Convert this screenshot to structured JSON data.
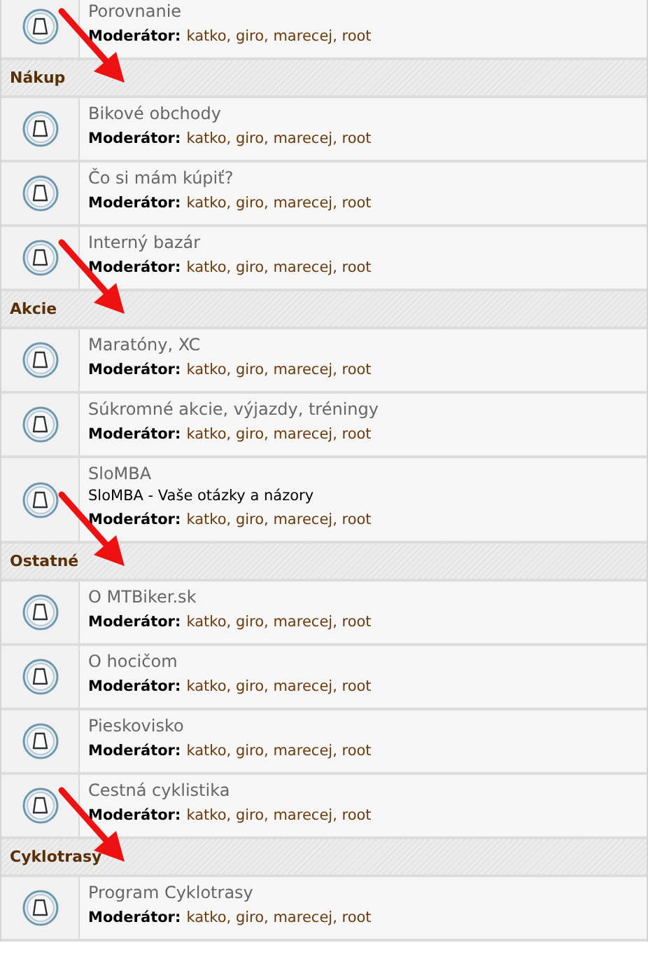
{
  "top_forums": [
    {
      "title": "Porovnanie",
      "moderator_label": "Moderátor:",
      "moderators": "katko, giro, marecej, root"
    }
  ],
  "categories": [
    {
      "name": "Nákup",
      "arrow": true,
      "forums": [
        {
          "title": "Bikové obchody",
          "moderator_label": "Moderátor:",
          "moderators": "katko, giro, marecej, root"
        },
        {
          "title": "Čo si mám kúpiť?",
          "moderator_label": "Moderátor:",
          "moderators": "katko, giro, marecej, root"
        },
        {
          "title": "Interný bazár",
          "moderator_label": "Moderátor:",
          "moderators": "katko, giro, marecej, root"
        }
      ]
    },
    {
      "name": "Akcie",
      "arrow": true,
      "forums": [
        {
          "title": "Maratóny, XC",
          "moderator_label": "Moderátor:",
          "moderators": "katko, giro, marecej, root"
        },
        {
          "title": "Súkromné akcie, výjazdy, tréningy",
          "moderator_label": "Moderátor:",
          "moderators": "katko, giro, marecej, root"
        },
        {
          "title": "SloMBA",
          "description": "SloMBA - Vaše otázky a názory",
          "moderator_label": "Moderátor:",
          "moderators": "katko, giro, marecej, root"
        }
      ]
    },
    {
      "name": "Ostatné",
      "arrow": true,
      "forums": [
        {
          "title": "O MTBiker.sk",
          "moderator_label": "Moderátor:",
          "moderators": "katko, giro, marecej, root"
        },
        {
          "title": "O hocičom",
          "moderator_label": "Moderátor:",
          "moderators": "katko, giro, marecej, root"
        },
        {
          "title": "Pieskovisko",
          "moderator_label": "Moderátor:",
          "moderators": "katko, giro, marecej, root"
        },
        {
          "title": "Cestná cyklistika",
          "moderator_label": "Moderátor:",
          "moderators": "katko, giro, marecej, root"
        }
      ]
    },
    {
      "name": "Cyklotrasy",
      "arrow": true,
      "forums": [
        {
          "title": "Program Cyklotrasy",
          "moderator_label": "Moderátor:",
          "moderators": "katko, giro, marecej, root"
        }
      ]
    }
  ]
}
